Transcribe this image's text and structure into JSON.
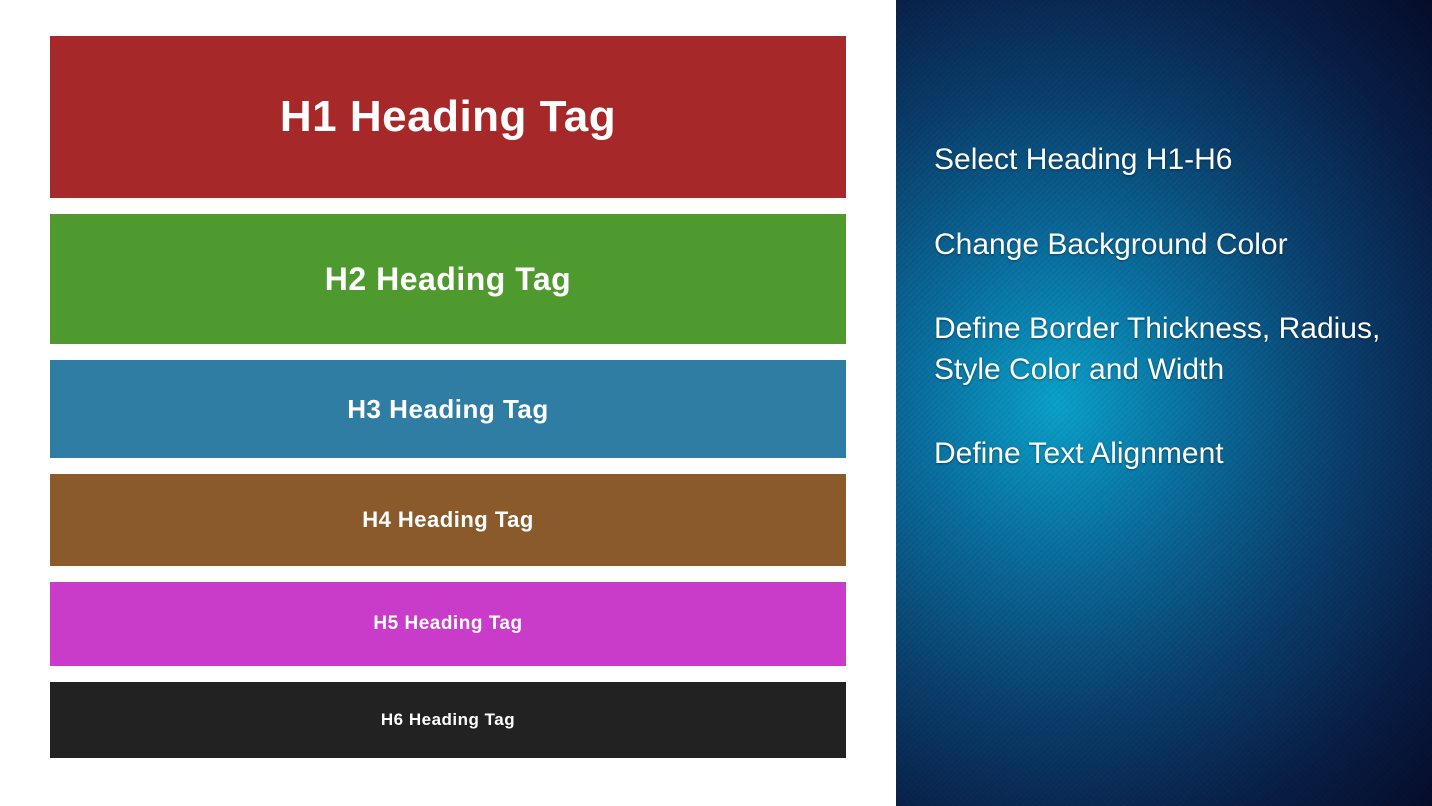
{
  "headings": {
    "h1": "H1 Heading Tag",
    "h2": "H2 Heading Tag",
    "h3": "H3 Heading Tag",
    "h4": "H4 Heading Tag",
    "h5": "H5 Heading Tag",
    "h6": "H6 Heading Tag"
  },
  "features": {
    "item1": "Select Heading H1-H6",
    "item2": "Change Background Color",
    "item3": "Define Border Thickness, Radius, Style Color and Width",
    "item4": "Define Text Alignment"
  },
  "colors": {
    "h1": "#a72828",
    "h2": "#4e9a2f",
    "h3": "#2f7da3",
    "h4": "#8a5a2b",
    "h5": "#c93bc9",
    "h6": "#222222"
  }
}
